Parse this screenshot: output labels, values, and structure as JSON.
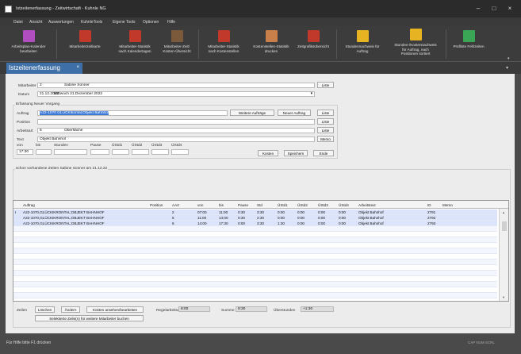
{
  "window": {
    "title": "Istzeitenerfassung - Zeitwirtschaft - Kuhnle NG"
  },
  "menu": [
    "Datei",
    "Ansicht",
    "Auswertungen",
    "KuhnleTools",
    "Eigene Tools",
    "Optionen",
    "Hilfe"
  ],
  "ribbon": [
    {
      "l1": "Arbeitsplan-Kalender",
      "l2": "bearbeiten",
      "icon": "calendar-icon",
      "color": "#b04ec0"
    },
    {
      "l1": "Mitarbeiterzeitkarte",
      "l2": "",
      "icon": "worker-card-icon",
      "color": "#c0392b"
    },
    {
      "l1": "Mitarbeiter-Statistik",
      "l2": "nach Kalendertagen",
      "icon": "statistics-calendar-icon",
      "color": "#c0392b"
    },
    {
      "l1": "Mitarbeiter-Zeit/",
      "l2": "Kosten-Übersicht",
      "icon": "time-cost-icon",
      "color": "#7a5a3a"
    },
    {
      "l1": "Mitarbeiter-Statistik",
      "l2": "nach Kostenstellen",
      "icon": "statistics-costcenter-icon",
      "color": "#c0392b"
    },
    {
      "l1": "Kostenstellen-Statistik",
      "l2": "drucken",
      "icon": "print-statistic-icon",
      "color": "#c87f4a"
    },
    {
      "l1": "Zeitgrafiksübersicht",
      "l2": "",
      "icon": "time-graph-icon",
      "color": "#c0392b"
    },
    {
      "l1": "Stundennachweis für",
      "l2": "Auftrag",
      "icon": "hours-order-icon",
      "color": "#e6b422"
    },
    {
      "l1": "Stunden-/Kostennachweis",
      "l2": "für Auftrag, nach",
      "l3": "Positionen sortiert",
      "icon": "hours-cost-order-icon",
      "color": "#e6b422"
    },
    {
      "l1": "Prüfliste Fehlzeiten",
      "l2": "",
      "icon": "checklist-icon",
      "color": "#3aa655"
    }
  ],
  "tab": {
    "label": "Istzeitenerfassung",
    "close": "×"
  },
  "form": {
    "mitarbeiter_label": "Mitarbeiter",
    "mitarbeiter_nr": "2",
    "mitarbeiter_name": "Sabine Sonner",
    "datum_label": "Datum",
    "datum_value": "21.12.2022",
    "datum_long": "Mittwoch  21.Dezember 2022",
    "liste": "Liste",
    "group1_title": "Erfassung Neuer Vorgang",
    "auftrag_label": "Auftrag",
    "auftrag_value": "A22-1070          GLÜCKIkontal;Objekt Bahnhof",
    "weitere_auftraege": "Weitere Aufträge",
    "neuer_auftrag": "Neuer Auftrag",
    "position_label": "Position",
    "arbeitsart_label": "Arbeitsart",
    "arbeitsart_nr": "6",
    "arbeitsart_name": "Oberfläche",
    "text_label": "Text",
    "text_value": "Objekt Bahnhof",
    "memo": "Memo",
    "von": "von",
    "bis": "bis",
    "stunden": "Stunden",
    "pause": "Pause",
    "ustd1": "ÜStd1",
    "ustd2": "ÜStd2",
    "ustd3": "ÜStd3",
    "ustd4": "ÜStd4",
    "von_value": "17:30",
    "kosten": "Kosten",
    "speichern": "Speichern",
    "ende": "Ende",
    "group2_title": "schon vorhandene Zeiten Sabine Sonner am 21.12.22"
  },
  "table": {
    "headers": [
      "Auftrag",
      "Position",
      "AArt",
      "von",
      "bis",
      "Pause",
      "Std",
      "ÜStd1",
      "ÜStd2",
      "ÜStd3",
      "ÜStd4",
      "Arbeitstext",
      "ID",
      "Memo"
    ],
    "rows": [
      [
        "A22-1070,GLÜCKIKRONTAL;OBJEKT BAHNHOF",
        "",
        "2",
        "07:00",
        "11:00",
        "0:30",
        "3:30",
        "0:00",
        "0:00",
        "0:00",
        "0:00",
        "Objekt Bahnhof",
        "2791",
        ""
      ],
      [
        "A22-1070,GLÜCKIKRONTAL;OBJEKT BAHNHOF",
        "",
        "5",
        "11:00",
        "14:00",
        "0:30",
        "2:30",
        "0:00",
        "0:00",
        "0:00",
        "0:00",
        "Objekt Bahnhof",
        "2792",
        ""
      ],
      [
        "A22-1070,GLÜCKIKRONTAL;OBJEKT BAHNHOF",
        "",
        "6",
        "14:00",
        "17:30",
        "0:00",
        "3:30",
        "1:30",
        "0:00",
        "0:00",
        "0:00",
        "Objekt Bahnhof",
        "2793",
        ""
      ]
    ]
  },
  "bottom": {
    "zeilen": "Zeilen",
    "loeschen": "Löschen",
    "aendern": "Ändern",
    "kosten_btn": "Kosten ansehen/bearbeiten",
    "regelarbeitszeit_label": "Regelarbeitszeit",
    "regelarbeitszeit": "8:00",
    "summe_label": "Summe",
    "summe": "9:30",
    "ueberstunden_label": "Überstunden",
    "ueberstunden": "+1:30",
    "selektierte": "Selektierte Zeile(n) für weitere Mitarbeiter buchen"
  },
  "status": {
    "left": "Für Hilfe bitte F1 drücken",
    "right": "CAP NUM SCRL"
  }
}
